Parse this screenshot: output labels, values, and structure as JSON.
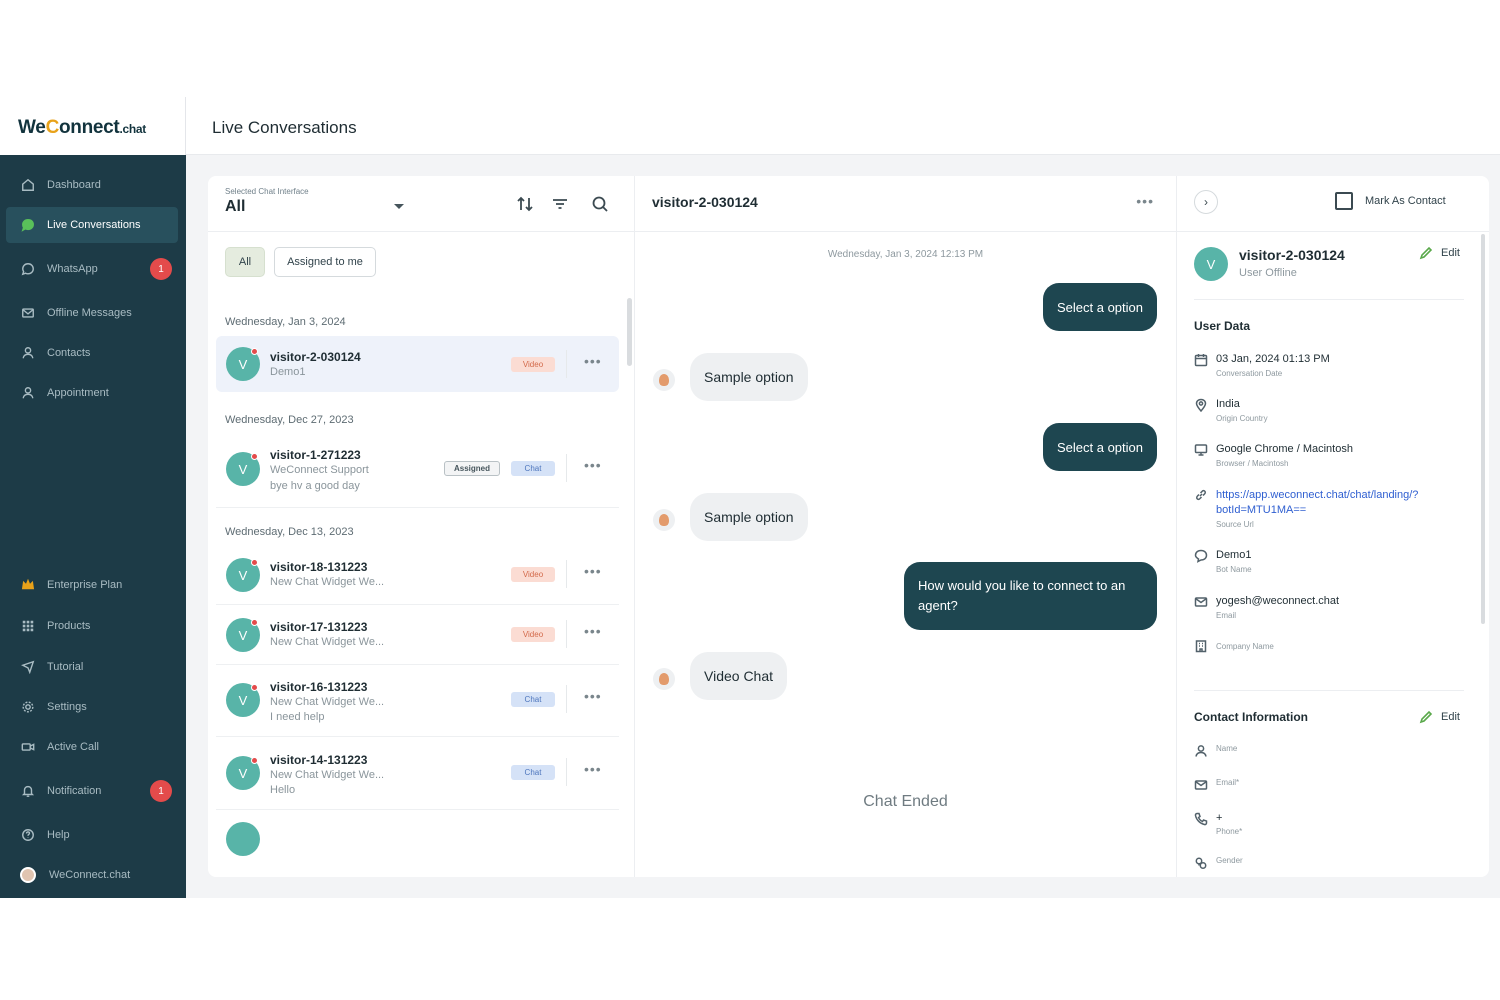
{
  "brand": {
    "we": "We",
    "c": "C",
    "onnect": "onnect",
    "dot_chat": ".chat"
  },
  "header": {
    "title": "Live Conversations"
  },
  "sidebar": {
    "items": [
      {
        "label": "Dashboard",
        "icon": "home-icon"
      },
      {
        "label": "Live Conversations",
        "icon": "chat-bubble-icon",
        "active": true
      },
      {
        "label": "WhatsApp",
        "icon": "whatsapp-icon",
        "badge": "1"
      },
      {
        "label": "Offline Messages",
        "icon": "mail-icon"
      },
      {
        "label": "Contacts",
        "icon": "user-icon"
      },
      {
        "label": "Appointment",
        "icon": "user-icon"
      },
      {
        "label": "Enterprise Plan",
        "icon": "crown-icon"
      },
      {
        "label": "Products",
        "icon": "grid-icon"
      },
      {
        "label": "Tutorial",
        "icon": "tutorial-icon"
      },
      {
        "label": "Settings",
        "icon": "gear-icon"
      },
      {
        "label": "Active Call",
        "icon": "video-icon"
      },
      {
        "label": "Notification",
        "icon": "bell-icon",
        "badge": "1"
      },
      {
        "label": "Help",
        "icon": "help-icon"
      },
      {
        "label": "WeConnect.chat",
        "icon": "avatar"
      }
    ]
  },
  "list": {
    "selector_label": "Selected Chat Interface",
    "selector_value": "All",
    "filters": [
      "All",
      "Assigned to me"
    ],
    "groups": [
      {
        "date": "Wednesday, Jan 3, 2024",
        "items": [
          {
            "name": "visitor-2-030124",
            "lines": [
              "Demo1"
            ],
            "tag": "Video",
            "selected": true
          }
        ]
      },
      {
        "date": "Wednesday, Dec 27, 2023",
        "items": [
          {
            "name": "visitor-1-271223",
            "lines": [
              "WeConnect Support",
              "bye hv a good day"
            ],
            "assigned": "Assigned",
            "tag": "Chat"
          }
        ]
      },
      {
        "date": "Wednesday, Dec 13, 2023",
        "items": [
          {
            "name": "visitor-18-131223",
            "lines": [
              "New Chat Widget We..."
            ],
            "tag": "Video"
          },
          {
            "name": "visitor-17-131223",
            "lines": [
              "New Chat Widget We..."
            ],
            "tag": "Video"
          },
          {
            "name": "visitor-16-131223",
            "lines": [
              "New Chat Widget We...",
              "I need help"
            ],
            "tag": "Chat"
          },
          {
            "name": "visitor-14-131223",
            "lines": [
              "New Chat Widget We...",
              "Hello"
            ],
            "tag": "Chat"
          }
        ]
      }
    ],
    "avatar_letter": "V"
  },
  "chat": {
    "title": "visitor-2-030124",
    "date": "Wednesday, Jan 3, 2024 12:13 PM",
    "messages": [
      {
        "from": "agent",
        "text": "Select a option"
      },
      {
        "from": "visitor",
        "text": "Sample option"
      },
      {
        "from": "agent",
        "text": "Select a option"
      },
      {
        "from": "visitor",
        "text": "Sample option"
      },
      {
        "from": "agent",
        "text": "How would you like to connect to an agent?"
      },
      {
        "from": "visitor",
        "text": "Video Chat"
      }
    ],
    "ended": "Chat Ended"
  },
  "info": {
    "mark_as_contact": "Mark As Contact",
    "name": "visitor-2-030124",
    "status": "User Offline",
    "avatar_letter": "V",
    "edit": "Edit",
    "user_data_title": "User Data",
    "user_data": [
      {
        "icon": "calendar-icon",
        "value": "03 Jan, 2024 01:13 PM",
        "label": "Conversation Date"
      },
      {
        "icon": "location-icon",
        "value": "India",
        "label": "Origin Country"
      },
      {
        "icon": "monitor-icon",
        "value": "Google Chrome / Macintosh",
        "label": "Browser / Macintosh"
      },
      {
        "icon": "link-icon",
        "value": "https://app.weconnect.chat/chat/landing/?botId=MTU1MA==",
        "label": "Source Url",
        "link": true
      },
      {
        "icon": "bot-icon",
        "value": "Demo1",
        "label": "Bot Name"
      },
      {
        "icon": "mail-icon",
        "value": "yogesh@weconnect.chat",
        "label": "Email"
      },
      {
        "icon": "building-icon",
        "value": "",
        "label": "Company Name"
      }
    ],
    "contact_title": "Contact Information",
    "contact_fields": [
      {
        "icon": "user-icon",
        "value": "",
        "label": "Name"
      },
      {
        "icon": "mail-icon",
        "value": "",
        "label": "Email*"
      },
      {
        "icon": "phone-icon",
        "value": "+",
        "label": "Phone*"
      },
      {
        "icon": "gender-icon",
        "value": "",
        "label": "Gender"
      }
    ]
  },
  "colors": {
    "sidebar": "#1d3b47",
    "accent_dark": "#1e4650",
    "avatar": "#58b4a8",
    "badge": "#e44b4b",
    "brand_c": "#e8a21a",
    "link": "#2f5fd1"
  }
}
